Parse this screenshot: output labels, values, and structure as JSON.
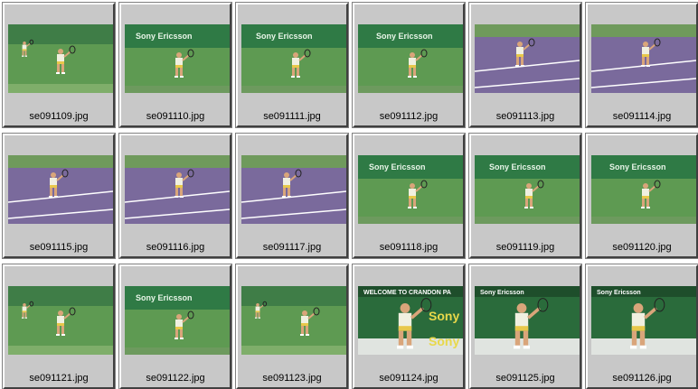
{
  "thumbnails": [
    {
      "filename": "se091109.jpg",
      "scene": "green-court"
    },
    {
      "filename": "se091110.jpg",
      "scene": "green-banner"
    },
    {
      "filename": "se091111.jpg",
      "scene": "green-banner"
    },
    {
      "filename": "se091112.jpg",
      "scene": "green-banner"
    },
    {
      "filename": "se091113.jpg",
      "scene": "purple-court"
    },
    {
      "filename": "se091114.jpg",
      "scene": "purple-court"
    },
    {
      "filename": "se091115.jpg",
      "scene": "purple-court"
    },
    {
      "filename": "se091116.jpg",
      "scene": "purple-court"
    },
    {
      "filename": "se091117.jpg",
      "scene": "purple-court"
    },
    {
      "filename": "se091118.jpg",
      "scene": "green-banner"
    },
    {
      "filename": "se091119.jpg",
      "scene": "green-banner"
    },
    {
      "filename": "se091120.jpg",
      "scene": "green-banner"
    },
    {
      "filename": "se091121.jpg",
      "scene": "green-court"
    },
    {
      "filename": "se091122.jpg",
      "scene": "green-banner"
    },
    {
      "filename": "se091123.jpg",
      "scene": "green-court"
    },
    {
      "filename": "se091124.jpg",
      "scene": "closeup-banner"
    },
    {
      "filename": "se091125.jpg",
      "scene": "closeup-banner"
    },
    {
      "filename": "se091126.jpg",
      "scene": "closeup-banner"
    }
  ],
  "banners": {
    "sponsor": "Sony Ericsson",
    "welcome": "WELCOME TO CRANDON PA",
    "sony": "Sony"
  },
  "colors": {
    "court_green": "#5e9a52",
    "court_purple": "#7a6a9c",
    "banner_green": "#2f7a45",
    "cell_bg": "#c8c8c8"
  }
}
